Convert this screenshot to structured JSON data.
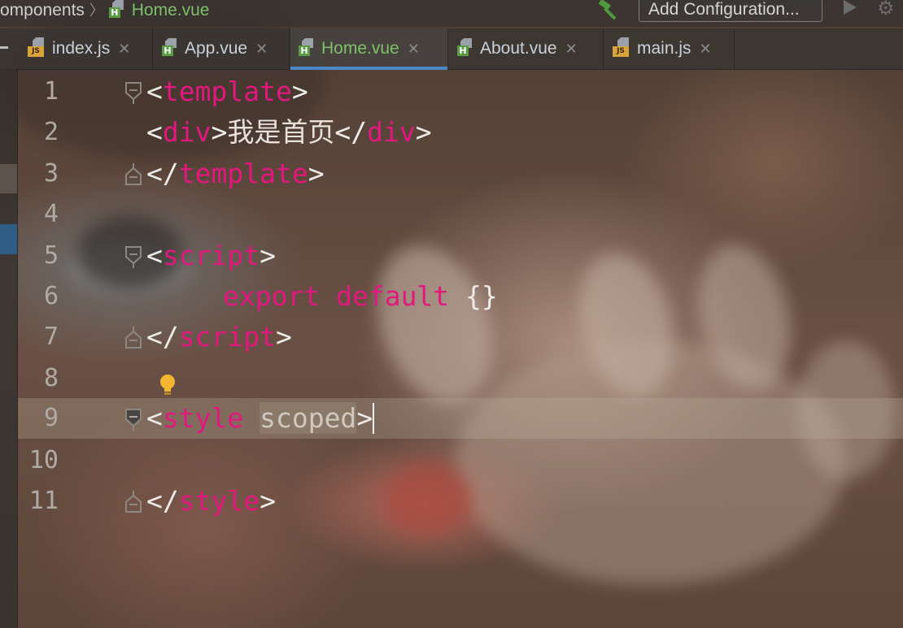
{
  "breadcrumb": {
    "parent": "omponents",
    "separator": "〉",
    "current_file": "Home.vue"
  },
  "toolbar": {
    "build_icon": "hammer-icon",
    "run_config_label": "Add Configuration...",
    "run_icon": "play-icon",
    "settings_icon": "gear-icon"
  },
  "tabs": [
    {
      "label": "index.js",
      "icon": "js-file-icon",
      "active": false
    },
    {
      "label": "App.vue",
      "icon": "vue-file-icon",
      "active": false
    },
    {
      "label": "Home.vue",
      "icon": "vue-file-icon",
      "active": true
    },
    {
      "label": "About.vue",
      "icon": "vue-file-icon",
      "active": false
    },
    {
      "label": "main.js",
      "icon": "js-file-icon",
      "active": false
    }
  ],
  "tab_close_glyph": "✕",
  "editor": {
    "current_line": 9,
    "line_numbers": [
      "1",
      "2",
      "3",
      "4",
      "5",
      "6",
      "7",
      "8",
      "9",
      "10",
      "11"
    ],
    "code": {
      "l1_open": "<",
      "l1_tag": "template",
      "l1_close": ">",
      "l2_open": "<",
      "l2_tag": "div",
      "l2_mid": ">",
      "l2_text": "我是首页",
      "l2_close_open": "</",
      "l2_close_tag": "div",
      "l2_close": ">",
      "l3_open": "</",
      "l3_tag": "template",
      "l3_close": ">",
      "l5_open": "<",
      "l5_tag": "script",
      "l5_close": ">",
      "l6_kw1": "export",
      "l6_kw2": "default",
      "l6_obj": "{}",
      "l7_open": "</",
      "l7_tag": "script",
      "l7_close": ">",
      "l9_open": "<",
      "l9_tag": "style",
      "l9_attr": "scoped",
      "l9_close": ">",
      "l11_open": "</",
      "l11_tag": "style",
      "l11_close": ">"
    }
  },
  "colors": {
    "tag": "#e2187f",
    "active_tab_text": "#7fbf6a",
    "active_tab_underline": "#4a88c7",
    "line_number": "#b0aaa6"
  }
}
